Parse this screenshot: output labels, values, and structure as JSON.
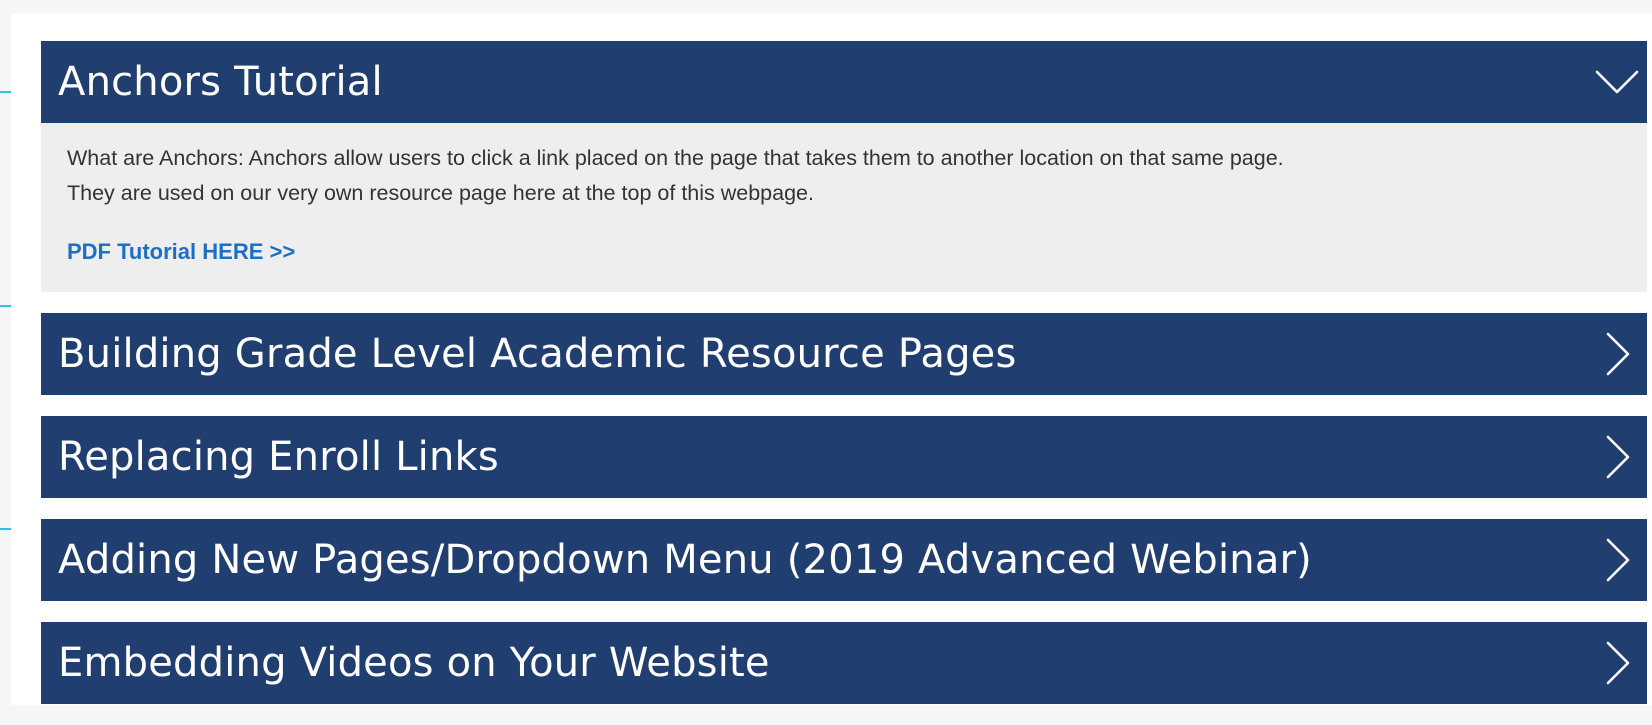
{
  "accordion": {
    "items": [
      {
        "title": "Anchors Tutorial",
        "expanded": true,
        "icon": "chevron-down-icon",
        "body_text_line1": "What are Anchors: Anchors allow users to click a link placed on the page that takes them to another location on that same page.",
        "body_text_line2": "They are used on our very own resource page here at the top of this webpage.",
        "link_label": "PDF Tutorial HERE >>"
      },
      {
        "title": "Building Grade Level Academic Resource Pages",
        "expanded": false,
        "icon": "chevron-right-icon"
      },
      {
        "title": "Replacing Enroll Links",
        "expanded": false,
        "icon": "chevron-right-icon"
      },
      {
        "title": "Adding New Pages/Dropdown Menu (2019 Advanced Webinar)",
        "expanded": false,
        "icon": "chevron-right-icon"
      },
      {
        "title": "Embedding Videos on Your Website",
        "expanded": false,
        "icon": "chevron-right-icon"
      }
    ]
  },
  "colors": {
    "header_bg": "#213e70",
    "header_text": "#ffffff",
    "body_bg": "#eeeeee",
    "link": "#1c6fc4",
    "guide_lines": "#2bc4e4"
  }
}
